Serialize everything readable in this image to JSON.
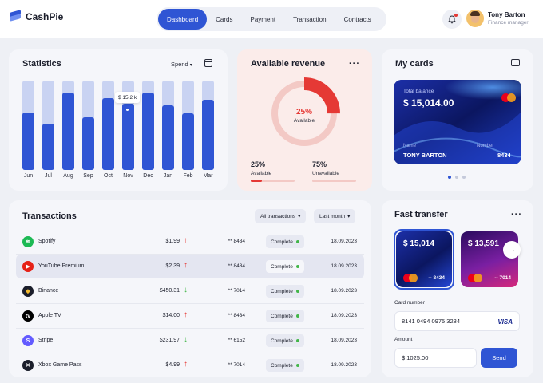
{
  "app": {
    "name": "CashPie"
  },
  "nav": {
    "items": [
      "Dashboard",
      "Cards",
      "Payment",
      "Transaction",
      "Contracts"
    ],
    "active": "Dashboard"
  },
  "user": {
    "name": "Tony Barton",
    "role": "Finance manager"
  },
  "statistics": {
    "title": "Statistics",
    "filter": "Spend",
    "tooltip": "$ 15.2 k",
    "months": [
      "Jun",
      "Jul",
      "Aug",
      "Sep",
      "Oct",
      "Nov",
      "Dec",
      "Jan",
      "Feb",
      "Mar"
    ],
    "fill_ratios": [
      0.64,
      0.52,
      0.87,
      0.59,
      0.8,
      0.74,
      0.87,
      0.72,
      0.63,
      0.79
    ]
  },
  "revenue": {
    "title": "Available revenue",
    "center_pct": "25%",
    "center_label": "Available",
    "available": {
      "pct": "25%",
      "label": "Available",
      "value": 25
    },
    "unavailable": {
      "pct": "75%",
      "label": "Unavailable",
      "value": 75
    },
    "colors": {
      "available": "#e53935",
      "unavailable": "#f3c9c5"
    }
  },
  "my_cards": {
    "title": "My cards",
    "total_balance_label": "Total balance",
    "total_balance": "$ 15,014.00",
    "name_label": "Name",
    "name_value": "TONY BARTON",
    "number_label": "Number",
    "number_value": "8434",
    "pages": 3,
    "active_page": 0
  },
  "transactions": {
    "title": "Transactions",
    "filter_type": "All transactions",
    "filter_period": "Last month",
    "rows": [
      {
        "name": "Spotify",
        "icon": "spotify-icon",
        "amount": "$1.99",
        "direction": "up",
        "card": "** 8434",
        "status": "Complete",
        "date": "18.09.2023"
      },
      {
        "name": "YouTube Premium",
        "icon": "youtube-icon",
        "amount": "$2.39",
        "direction": "up",
        "card": "** 8434",
        "status": "Complete",
        "date": "18.09.2023"
      },
      {
        "name": "Binance",
        "icon": "binance-icon",
        "amount": "$450.31",
        "direction": "down",
        "card": "** 7014",
        "status": "Complete",
        "date": "18.09.2023"
      },
      {
        "name": "Apple TV",
        "icon": "apple-tv-icon",
        "amount": "$14.00",
        "direction": "up",
        "card": "** 8434",
        "status": "Complete",
        "date": "18.09.2023"
      },
      {
        "name": "Stripe",
        "icon": "stripe-icon",
        "amount": "$231.97",
        "direction": "down",
        "card": "** 6152",
        "status": "Complete",
        "date": "18.09.2023"
      },
      {
        "name": "Xbox Game Pass",
        "icon": "xbox-icon",
        "amount": "$4.99",
        "direction": "up",
        "card": "** 7014",
        "status": "Complete",
        "date": "18.09.2023"
      }
    ]
  },
  "fast_transfer": {
    "title": "Fast transfer",
    "cards": [
      {
        "amount": "$ 15,014",
        "number": "-- 8434"
      },
      {
        "amount": "$ 13,591",
        "number": "-- 7014"
      }
    ],
    "card_number_label": "Card number",
    "card_number": "8141 0494 0975 3284",
    "card_brand": "VISA",
    "amount_label": "Amount",
    "amount": "$ 1025.00",
    "send_label": "Send"
  },
  "colors": {
    "accent": "#2f55d4",
    "bar_bg": "#c9d3f2",
    "up": "#e53935",
    "down": "#43b649"
  }
}
